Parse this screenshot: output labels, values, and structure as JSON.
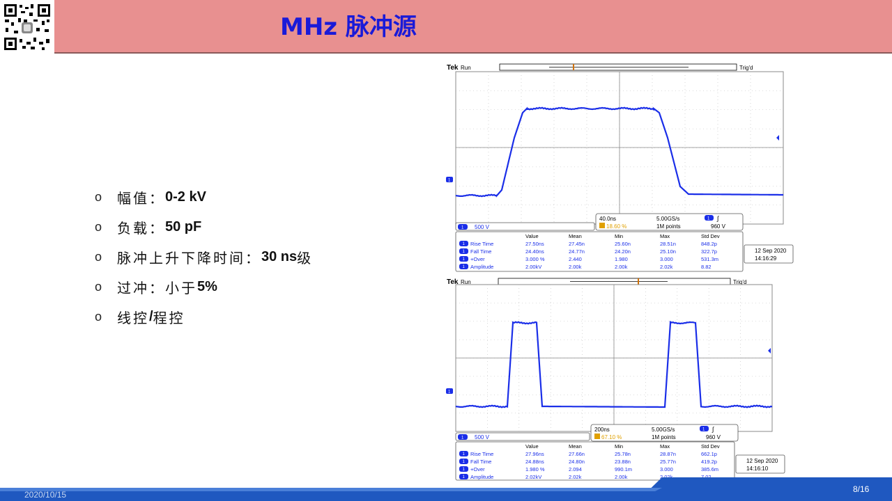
{
  "header": {
    "title": "MHz 脉冲源"
  },
  "bullets": [
    {
      "label": "幅值：",
      "value": "0-2 kV"
    },
    {
      "label": "负载：",
      "value": "50 pF"
    },
    {
      "label": "脉冲上升下降时间：",
      "value": "30 ns",
      "suffix": "级"
    },
    {
      "label": "过冲：小于",
      "value": "5%"
    },
    {
      "label": "线控",
      "value": "/",
      "suffix": "程控"
    }
  ],
  "footer": {
    "date": "2020/10/15",
    "page": "8/16"
  },
  "scopes": [
    {
      "brand": "Tek",
      "mode": "Run",
      "trig": "Trig'd",
      "ch_scale": "500 V",
      "timebase": "40.0ns",
      "sample_rate": "5.00GS/s",
      "points": "1M points",
      "trigger_pos": "18.60 %",
      "trigger_level": "960 V",
      "meas_headers": [
        "Value",
        "Mean",
        "Min",
        "Max",
        "Std Dev"
      ],
      "measurements": [
        {
          "name": "Rise Time",
          "values": [
            "27.50ns",
            "27.45n",
            "25.60n",
            "28.51n",
            "848.2p"
          ]
        },
        {
          "name": "Fall Time",
          "values": [
            "24.40ns",
            "24.77n",
            "24.20n",
            "25.10n",
            "322.7p"
          ]
        },
        {
          "name": "+Over",
          "values": [
            "3.000 %",
            "2.440",
            "1.980",
            "3.000",
            "531.3m"
          ]
        },
        {
          "name": "Amplitude",
          "values": [
            "2.00kV",
            "2.00k",
            "2.00k",
            "2.02k",
            "8.82"
          ]
        }
      ],
      "date": "12 Sep 2020",
      "time": "14:16:29"
    },
    {
      "brand": "Tek",
      "mode": "Run",
      "trig": "Trig'd",
      "ch_scale": "500 V",
      "timebase": "200ns",
      "sample_rate": "5.00GS/s",
      "points": "1M points",
      "trigger_pos": "67.10 %",
      "trigger_level": "960 V",
      "meas_headers": [
        "Value",
        "Mean",
        "Min",
        "Max",
        "Std Dev"
      ],
      "measurements": [
        {
          "name": "Rise Time",
          "values": [
            "27.96ns",
            "27.66n",
            "25.78n",
            "28.87n",
            "662.1p"
          ]
        },
        {
          "name": "Fall Time",
          "values": [
            "24.88ns",
            "24.80n",
            "23.88n",
            "25.77n",
            "419.2p"
          ]
        },
        {
          "name": "+Over",
          "values": [
            "1.980 %",
            "2.094",
            "990.1m",
            "3.000",
            "385.6m"
          ]
        },
        {
          "name": "Amplitude",
          "values": [
            "2.02kV",
            "2.02k",
            "2.00k",
            "2.02k",
            "7.02"
          ]
        }
      ],
      "date": "12 Sep 2020",
      "time": "14:16:10"
    }
  ],
  "colors": {
    "header_bg": "#e89090",
    "title": "#1a1ad8",
    "trace": "#1a2ee8",
    "footer": "#1f58c0"
  }
}
